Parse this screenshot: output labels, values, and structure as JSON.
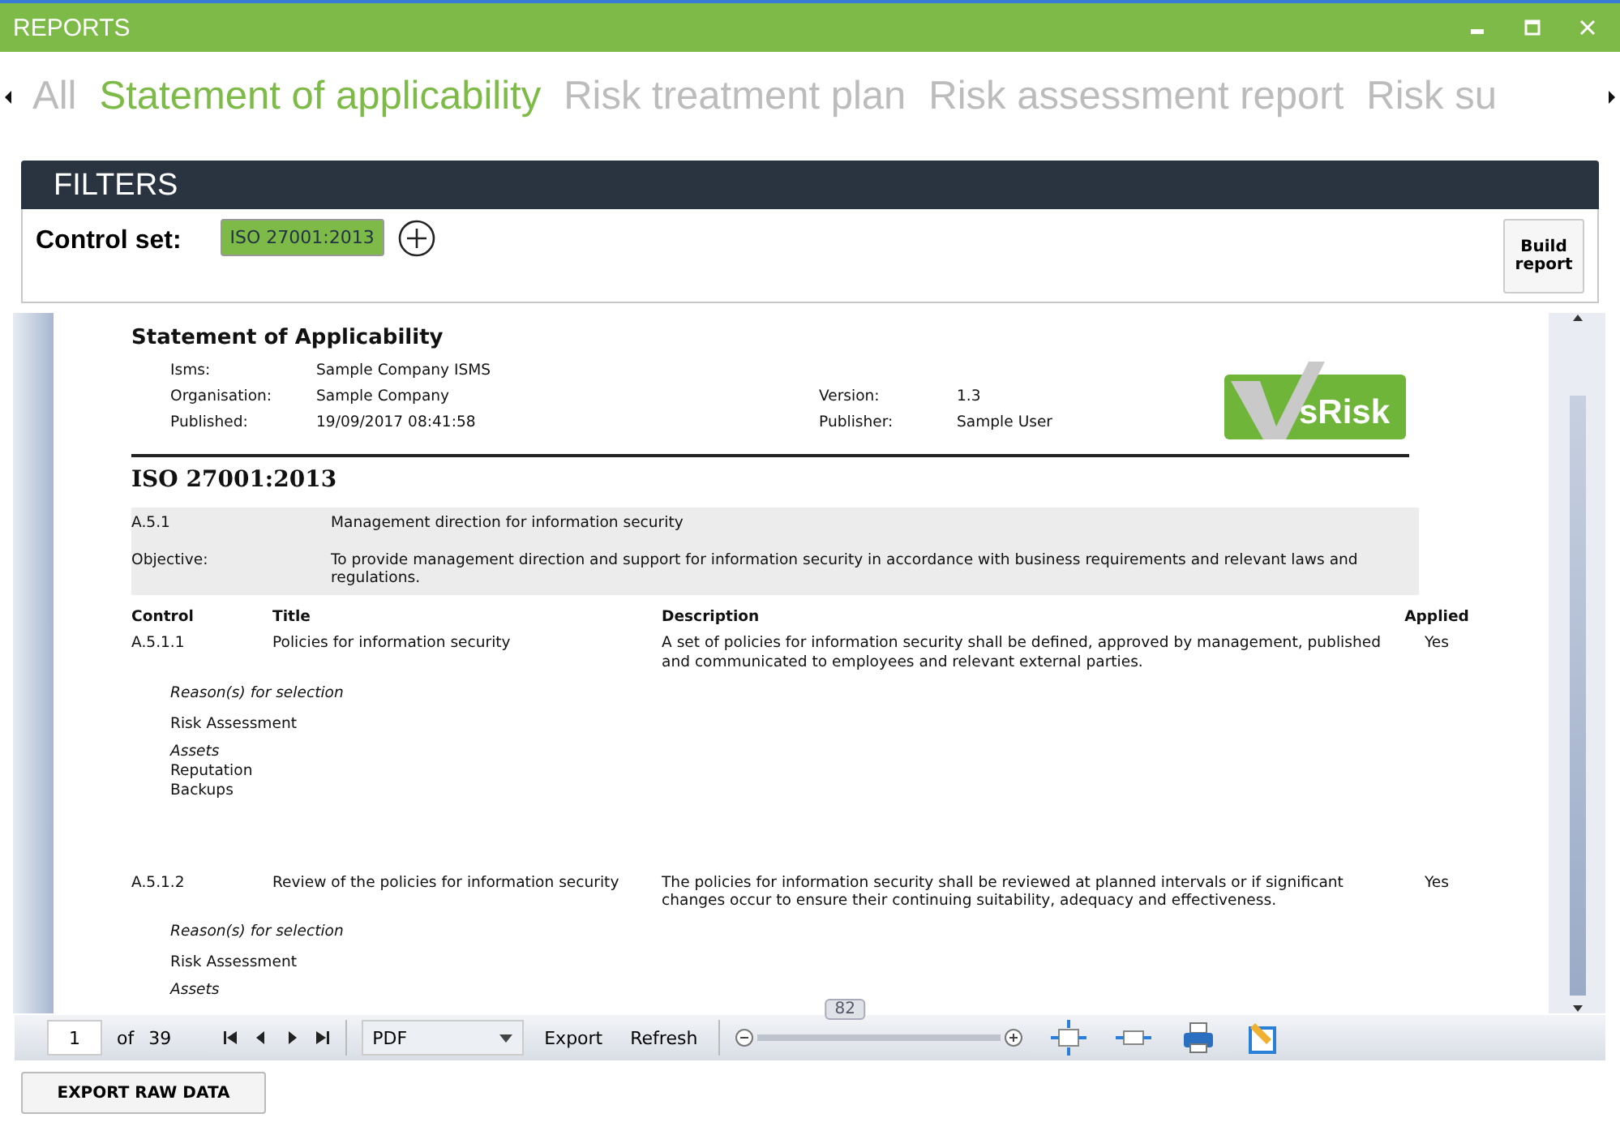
{
  "window": {
    "title": "REPORTS"
  },
  "tabs": [
    {
      "label": "All",
      "selected": false
    },
    {
      "label": "Statement of applicability",
      "selected": true
    },
    {
      "label": "Risk treatment plan",
      "selected": false
    },
    {
      "label": "Risk assessment report",
      "selected": false
    },
    {
      "label": "Risk su",
      "selected": false
    }
  ],
  "filters": {
    "title": "FILTERS",
    "control_set_label": "Control set:",
    "control_sets": [
      "ISO 27001:2013"
    ],
    "build_button": "Build report"
  },
  "report": {
    "title": "Statement of Applicability",
    "meta": [
      {
        "label": "Isms:",
        "value": "Sample Company ISMS"
      },
      {
        "label": "Organisation:",
        "value": "Sample Company"
      },
      {
        "label": "Published:",
        "value": "19/09/2017 08:41:58"
      }
    ],
    "meta_right": [
      {
        "label": "Version:",
        "value": "1.3"
      },
      {
        "label": "Publisher:",
        "value": "Sample User"
      }
    ],
    "logo": "sRisk",
    "section": "ISO 27001:2013",
    "group": {
      "code": "A.5.1",
      "name": "Management direction for information security",
      "objective_label": "Objective:",
      "objective": "To provide management direction and support for information security in accordance with business requirements and relevant laws and regulations."
    },
    "columns": [
      "Control",
      "Title",
      "Description",
      "Applied"
    ],
    "controls": [
      {
        "control": "A.5.1.1",
        "title": "Policies for information security",
        "description": "A set of policies for information security shall be defined, approved by management, published and communicated to employees and relevant external parties.",
        "applied": "Yes",
        "reasons_label": "Reason(s) for selection",
        "reasons": [
          "Risk Assessment"
        ],
        "assets_label": "Assets",
        "assets": [
          "Reputation",
          "Backups"
        ]
      },
      {
        "control": "A.5.1.2",
        "title": "Review of the policies for information security",
        "description": "The policies for information security shall be reviewed at planned intervals or if significant changes occur to ensure their continuing suitability, adequacy and effectiveness.",
        "applied": "Yes",
        "reasons_label": "Reason(s) for selection",
        "reasons": [
          "Risk Assessment"
        ],
        "assets_label": "Assets"
      }
    ]
  },
  "toolbar": {
    "page": "1",
    "of_label": "of",
    "page_count": "39",
    "format": "PDF",
    "export": "Export",
    "refresh": "Refresh",
    "zoom": {
      "reading": "82",
      "level": 0.36
    }
  },
  "export_raw_button": "EXPORT RAW DATA"
}
